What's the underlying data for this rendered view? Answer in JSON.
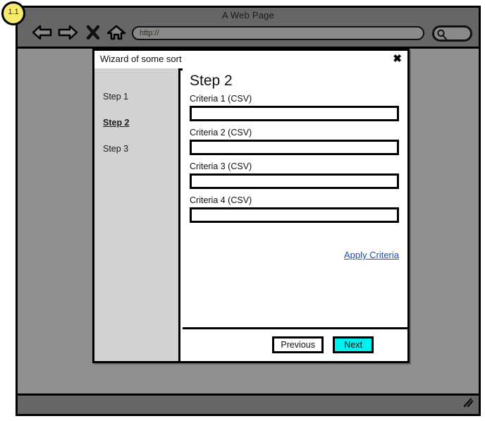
{
  "annotation": {
    "number": "1.1"
  },
  "browser": {
    "title": "A Web Page",
    "url_value": "http://",
    "url_placeholder": "http://",
    "search_value": "",
    "search_placeholder": "",
    "icons": {
      "back": "back-arrow-icon",
      "forward": "forward-arrow-icon",
      "stop": "stop-x-icon",
      "home": "home-icon",
      "search": "search-magnifier-icon",
      "resize": "resize-grip-icon"
    }
  },
  "dialog": {
    "title": "Wizard of some sort",
    "close_label": "✖",
    "sidebar": {
      "steps": [
        {
          "label": "Step 1",
          "active": false
        },
        {
          "label": "Step 2",
          "active": true
        },
        {
          "label": "Step 3",
          "active": false
        }
      ]
    },
    "main": {
      "heading": "Step 2",
      "fields": [
        {
          "label": "Criteria 1 (CSV)",
          "value": "",
          "placeholder": ""
        },
        {
          "label": "Criteria 2 (CSV)",
          "value": "",
          "placeholder": ""
        },
        {
          "label": "Criteria 3 (CSV)",
          "value": "",
          "placeholder": ""
        },
        {
          "label": "Criteria 4 (CSV)",
          "value": "",
          "placeholder": ""
        }
      ],
      "apply_link": "Apply Criteria"
    },
    "footer": {
      "previous_label": "Previous",
      "next_label": "Next"
    }
  },
  "colors": {
    "chrome": "#666666",
    "page_background": "#909090",
    "sidebar": "#d2d2d2",
    "accent_next": "#00f0f0",
    "link": "#1a4fb4",
    "annotation": "#f5ec6e"
  }
}
